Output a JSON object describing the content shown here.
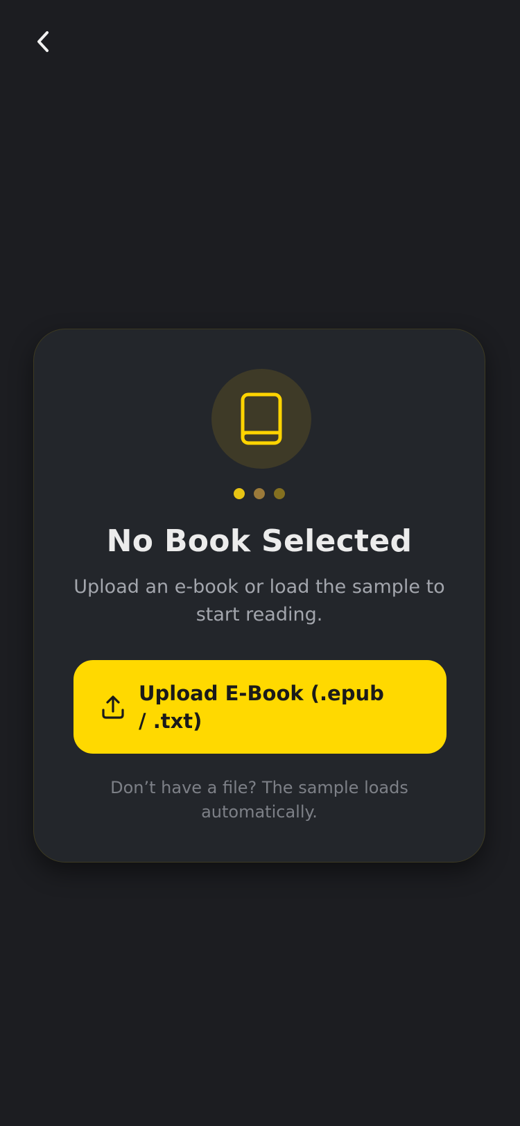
{
  "nav": {
    "back_icon": "chevron-left-icon"
  },
  "empty_state": {
    "icon": "book-icon",
    "title": "No Book Selected",
    "subtitle": "Upload an e-book or load the sample to start reading.",
    "upload_button": {
      "icon": "upload-icon",
      "label": "Upload E-Book (.epub / .txt)"
    },
    "hint": "Don’t have a file? The sample loads automatically."
  },
  "colors": {
    "background": "#1c1d21",
    "card": "#23262b",
    "accent": "#ffd900",
    "dot_1": "#e8c414",
    "dot_2": "#9b7a3a",
    "dot_3": "#847020"
  }
}
